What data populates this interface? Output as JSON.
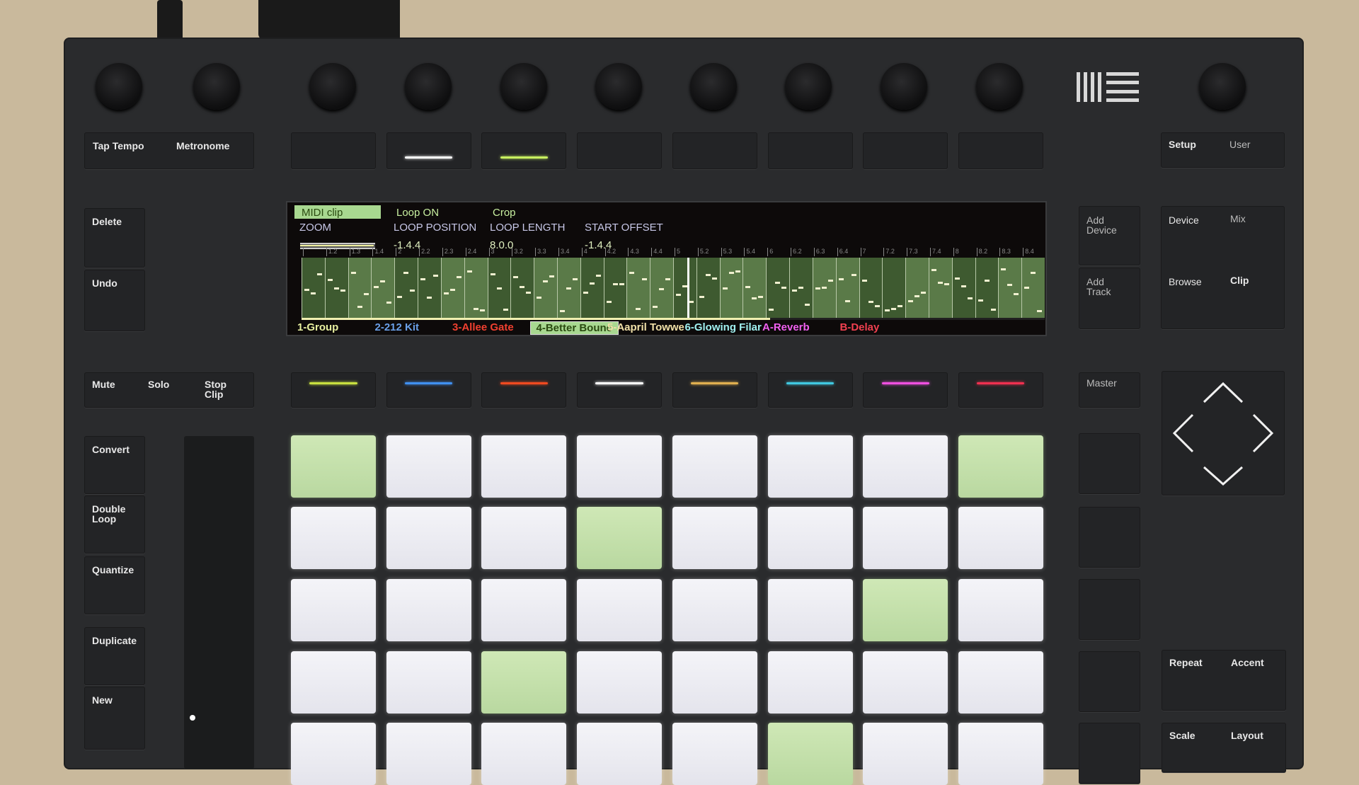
{
  "device": {
    "logo": "Ableton"
  },
  "left_buttons": {
    "tap_tempo": "Tap Tempo",
    "metronome": "Metronome",
    "delete": "Delete",
    "undo": "Undo",
    "mute": "Mute",
    "solo": "Solo",
    "stop_clip": "Stop Clip",
    "convert": "Convert",
    "double_loop": "Double Loop",
    "quantize": "Quantize",
    "duplicate": "Duplicate",
    "new": "New"
  },
  "right_buttons": {
    "setup": "Setup",
    "user": "User",
    "add_device": "Add Device",
    "add_track": "Add Track",
    "device": "Device",
    "mix": "Mix",
    "browse": "Browse",
    "clip": "Clip",
    "master": "Master",
    "repeat": "Repeat",
    "accent": "Accent",
    "scale": "Scale",
    "layout": "Layout"
  },
  "display": {
    "clip_type": "MIDI clip",
    "loop_toggle": "Loop ON",
    "crop": "Crop",
    "params": [
      {
        "label": "ZOOM",
        "value": ""
      },
      {
        "label": "LOOP POSITION",
        "value": "-1.4.4"
      },
      {
        "label": "LOOP LENGTH",
        "value": "8.0.0"
      },
      {
        "label": "START OFFSET",
        "value": "-1.4.4"
      }
    ],
    "ruler": [
      "",
      "1.2",
      "1.3",
      "1.4",
      "2",
      "2.2",
      "2.3",
      "2.4",
      "3",
      "3.2",
      "3.3",
      "3.4",
      "4",
      "4.2",
      "4.3",
      "4.4",
      "5",
      "5.2",
      "5.3",
      "5.4",
      "6",
      "6.2",
      "6.3",
      "6.4",
      "7",
      "7.2",
      "7.3",
      "7.4",
      "8",
      "8.2",
      "8.3",
      "8.4"
    ],
    "tracks": [
      {
        "name": "1-Group",
        "color": "#e8f0a0"
      },
      {
        "name": "2-212 Kit",
        "color": "#6aa0e8"
      },
      {
        "name": "3-Allee Gate",
        "color": "#f04030"
      },
      {
        "name": "4-Better Bounc",
        "color": "#2a4a10",
        "selected": true
      },
      {
        "name": "5-Aapril Towwe",
        "color": "#f0e0a8"
      },
      {
        "name": "6-Glowing Filar",
        "color": "#a0f0f0"
      },
      {
        "name": "A-Reverb",
        "color": "#f060f0"
      },
      {
        "name": "B-Delay",
        "color": "#f04050"
      }
    ]
  },
  "top_track_leds": [
    "",
    "#ffffff",
    "#c8f060",
    "",
    "",
    "",
    "",
    ""
  ],
  "bottom_track_leds": [
    "#c8e040",
    "#4090f0",
    "#f04a20",
    "#ffffff",
    "#e0b050",
    "#40c8e0",
    "#f050e0",
    "#f03050"
  ],
  "pads": [
    [
      1,
      0,
      0,
      0,
      0,
      0,
      0,
      1
    ],
    [
      0,
      0,
      0,
      1,
      0,
      0,
      0,
      0
    ],
    [
      0,
      0,
      0,
      0,
      0,
      0,
      1,
      0
    ],
    [
      0,
      0,
      1,
      0,
      0,
      0,
      0,
      0
    ],
    [
      0,
      0,
      0,
      0,
      0,
      1,
      0,
      0
    ]
  ]
}
